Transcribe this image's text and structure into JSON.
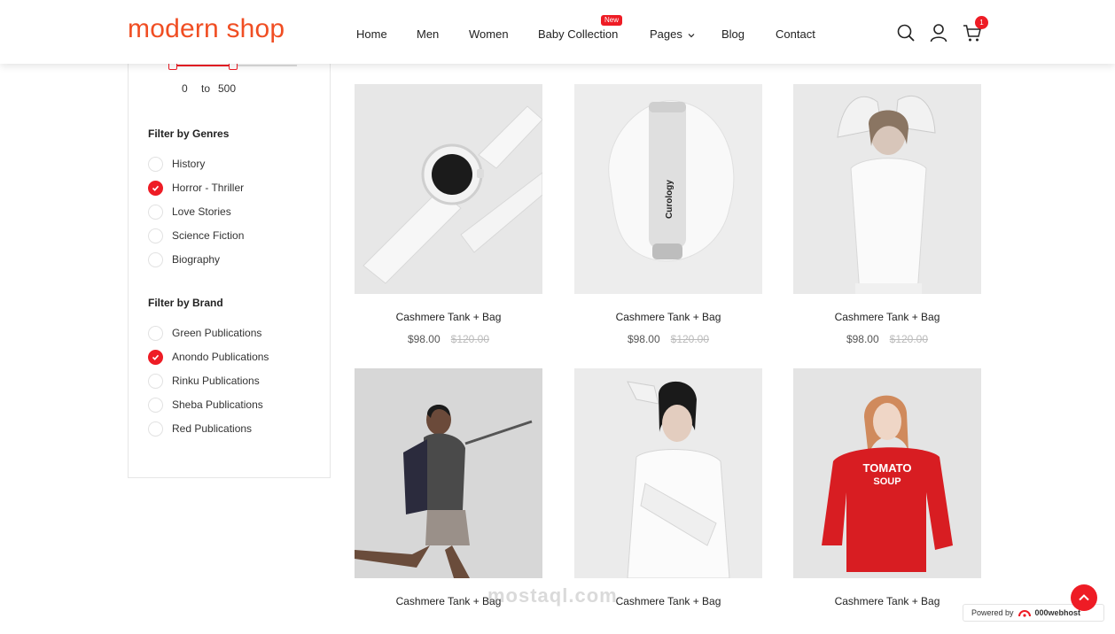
{
  "header": {
    "logo": "modern shop",
    "nav": [
      {
        "label": "Home"
      },
      {
        "label": "Men"
      },
      {
        "label": "Women"
      },
      {
        "label": "Baby Collection",
        "badge": "New"
      },
      {
        "label": "Pages",
        "icon": "chevron-down-icon"
      },
      {
        "label": "Blog"
      },
      {
        "label": "Contact"
      }
    ],
    "icons": [
      "search-icon",
      "user-icon",
      "cart-icon"
    ],
    "cart_count": "1"
  },
  "sidebar": {
    "price_range": {
      "min": "0",
      "separator": "to",
      "max": "500"
    },
    "genres": {
      "title": "Filter by Genres",
      "items": [
        {
          "label": "History",
          "checked": false
        },
        {
          "label": "Horror - Thriller",
          "checked": true
        },
        {
          "label": "Love Stories",
          "checked": false
        },
        {
          "label": "Science Fiction",
          "checked": false
        },
        {
          "label": "Biography",
          "checked": false
        }
      ]
    },
    "brands": {
      "title": "Filter by Brand",
      "items": [
        {
          "label": "Green Publications",
          "checked": false
        },
        {
          "label": "Anondo Publications",
          "checked": true
        },
        {
          "label": "Rinku Publications",
          "checked": false
        },
        {
          "label": "Sheba Publications",
          "checked": false
        },
        {
          "label": "Red Publications",
          "checked": false
        }
      ]
    }
  },
  "products": [
    {
      "name": "Cashmere Tank + Bag",
      "price": "$98.00",
      "old_price": "$120.00",
      "image": "white-smartwatch"
    },
    {
      "name": "Cashmere Tank + Bag",
      "price": "$98.00",
      "old_price": "$120.00",
      "image": "curology-bottle",
      "image_text": "Curology"
    },
    {
      "name": "Cashmere Tank + Bag",
      "price": "$98.00",
      "old_price": "$120.00",
      "image": "woman-white-top"
    },
    {
      "name": "Cashmere Tank + Bag",
      "price": "",
      "old_price": "",
      "image": "model-backpack"
    },
    {
      "name": "Cashmere Tank + Bag",
      "price": "",
      "old_price": "",
      "image": "woman-white-shirt"
    },
    {
      "name": "Cashmere Tank + Bag",
      "price": "",
      "old_price": "",
      "image": "woman-red-sweater",
      "image_text": "TOMATO SOUP"
    }
  ],
  "footer": {
    "watermark": "mostaql.com",
    "powered_by": "Powered by",
    "host": "000webhost"
  },
  "colors": {
    "accent": "#ee1c25",
    "logo": "#f04e23"
  }
}
